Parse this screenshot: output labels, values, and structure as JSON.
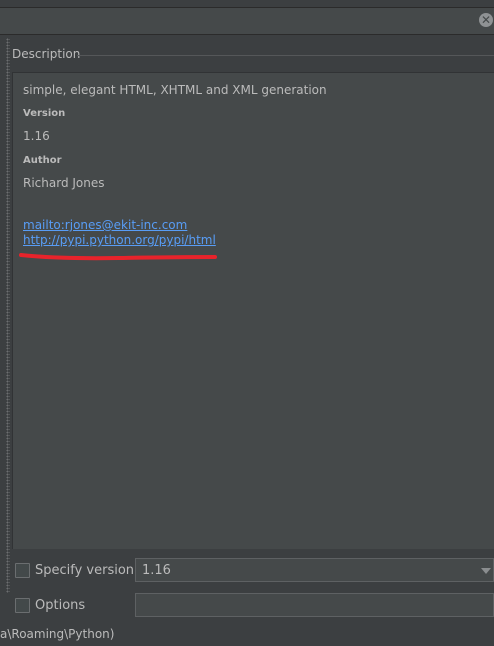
{
  "description": {
    "header": "Description",
    "summary": "simple, elegant HTML, XHTML and XML generation",
    "version_label": "Version",
    "version_value": "1.16",
    "author_label": "Author",
    "author_value": "Richard Jones",
    "links": [
      "mailto:rjones@ekit-inc.com",
      "http://pypi.python.org/pypi/html"
    ]
  },
  "controls": {
    "specify_version_label": "Specify version",
    "specify_version_value": "1.16",
    "options_label": "Options",
    "options_value": ""
  },
  "footer": {
    "path": "a\\Roaming\\Python)"
  },
  "icons": {
    "close": "close-icon",
    "dropdown": "chevron-down-icon"
  },
  "colors": {
    "link": "#589df6",
    "annotation": "#e8232b"
  }
}
